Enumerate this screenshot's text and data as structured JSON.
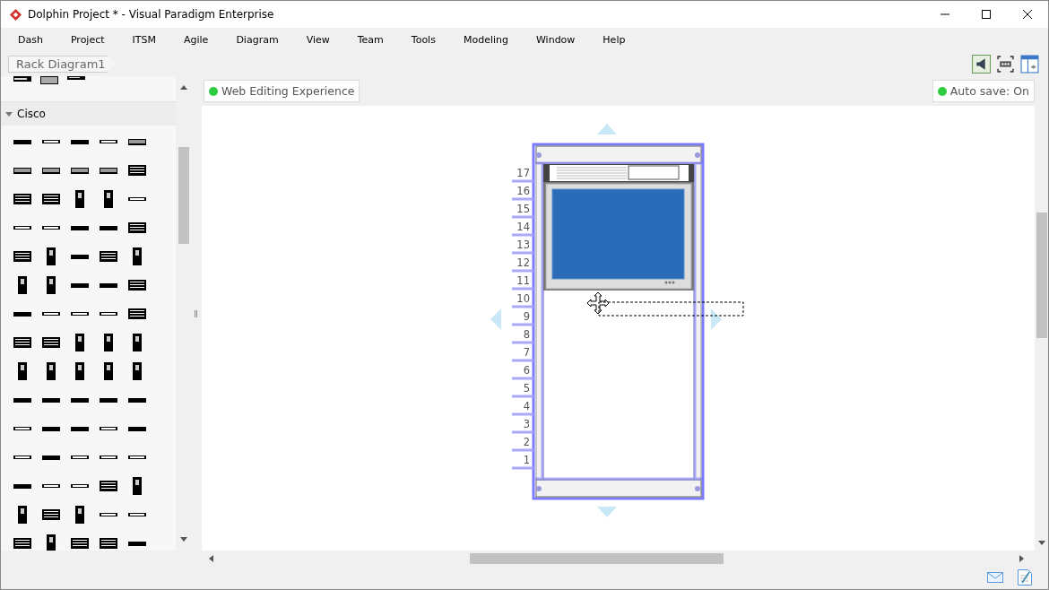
{
  "window": {
    "title": "Dolphin Project * - Visual Paradigm Enterprise"
  },
  "menu": [
    "Dash",
    "Project",
    "ITSM",
    "Agile",
    "Diagram",
    "View",
    "Team",
    "Tools",
    "Modeling",
    "Window",
    "Help"
  ],
  "breadcrumb": "Rack Diagram1",
  "palette": {
    "group": {
      "label": "Cisco",
      "expanded": true
    }
  },
  "web_editing": "Web Editing Experience",
  "auto_save": "Auto save: On",
  "rack": {
    "units": [
      "17",
      "16",
      "15",
      "14",
      "13",
      "12",
      "11",
      "10",
      "9",
      "8",
      "7",
      "6",
      "5",
      "4",
      "3",
      "2",
      "1"
    ]
  }
}
